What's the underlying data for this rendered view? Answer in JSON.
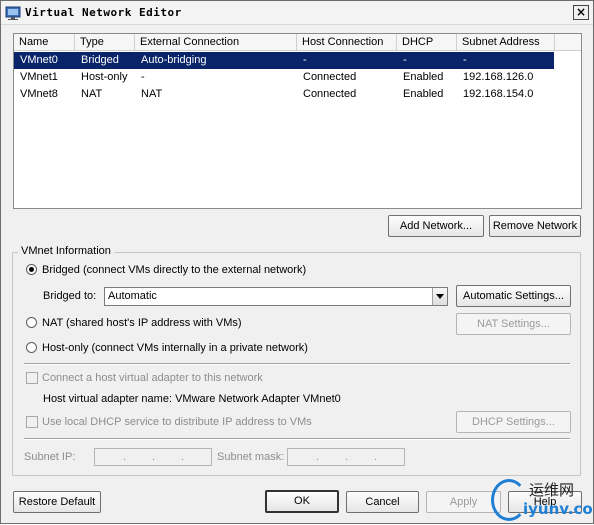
{
  "window": {
    "title": "Virtual Network Editor",
    "close_glyph": "×"
  },
  "table": {
    "columns": [
      "Name",
      "Type",
      "External Connection",
      "Host Connection",
      "DHCP",
      "Subnet Address"
    ],
    "rows": [
      [
        "VMnet0",
        "Bridged",
        "Auto-bridging",
        "-",
        "-",
        "-"
      ],
      [
        "VMnet1",
        "Host-only",
        "-",
        "Connected",
        "Enabled",
        "192.168.126.0"
      ],
      [
        "VMnet8",
        "NAT",
        "NAT",
        "Connected",
        "Enabled",
        "192.168.154.0"
      ]
    ],
    "selected_row": 0
  },
  "buttons": {
    "add_network": "Add Network...",
    "remove_network": "Remove Network",
    "automatic_settings": "Automatic Settings...",
    "nat_settings": "NAT Settings...",
    "dhcp_settings": "DHCP Settings...",
    "restore_default": "Restore Default",
    "ok": "OK",
    "cancel": "Cancel",
    "apply": "Apply",
    "help": "Help"
  },
  "vmnet_info": {
    "group_title": "VMnet Information",
    "radio_bridged": "Bridged (connect VMs directly to the external network)",
    "bridged_to_label": "Bridged to:",
    "bridged_to_value": "Automatic",
    "radio_nat": "NAT (shared host's IP address with VMs)",
    "radio_hostonly": "Host-only (connect VMs internally in a private network)",
    "selected_mode": "bridged",
    "connect_adapter": "Connect a host virtual adapter to this network",
    "host_adapter_name": "Host virtual adapter name: VMware Network Adapter VMnet0",
    "use_dhcp": "Use local DHCP service to distribute IP address to VMs",
    "subnet_ip_label": "Subnet IP:",
    "subnet_mask_label": "Subnet mask:"
  },
  "watermark": {
    "top": "运维网",
    "bottom": "iyunv.com"
  },
  "colors": {
    "selection": "#0a246a",
    "window_bg": "#f0f0f0",
    "accent": "#1e7fd4"
  }
}
